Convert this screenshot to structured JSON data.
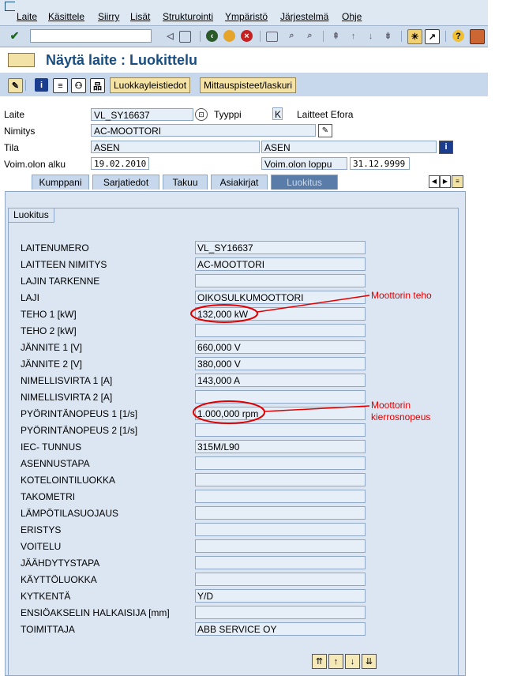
{
  "menu": {
    "items": [
      "Laite",
      "Käsittele",
      "Siirry",
      "Lisät",
      "Strukturointi",
      "Ympäristö",
      "Järjestelmä",
      "Ohje"
    ]
  },
  "title": "Näytä laite : Luokittelu",
  "app_buttons": {
    "general_data": "Luokkayleistiedot",
    "measuring_points": "Mittauspisteet/laskuri"
  },
  "header": {
    "equipment_label": "Laite",
    "equipment_value": "VL_SY16637",
    "type_label": "Tyyppi",
    "type_value": "K",
    "category_text": "Laitteet Efora",
    "description_label": "Nimitys",
    "description_value": "AC-MOOTTORI",
    "status_label": "Tila",
    "status_value_1": "ASEN",
    "status_value_2": "ASEN",
    "valid_from_label": "Voim.olon alku",
    "valid_from_value": "19.02.2010",
    "valid_to_label": "Voim.olon loppu",
    "valid_to_value": "31.12.9999"
  },
  "tabs": [
    "Kumppani",
    "Sarjatiedot",
    "Takuu",
    "Asiakirjat",
    "Luokitus"
  ],
  "group_title": "Luokitus",
  "characteristics": [
    {
      "label": "LAITENUMERO",
      "value": "VL_SY16637"
    },
    {
      "label": "LAITTEEN NIMITYS",
      "value": "AC-MOOTTORI"
    },
    {
      "label": "LAJIN TARKENNE",
      "value": ""
    },
    {
      "label": "LAJI",
      "value": "OIKOSULKUMOOTTORI"
    },
    {
      "label": "TEHO 1 [kW]",
      "value": "132,000 kW"
    },
    {
      "label": "TEHO 2 [kW]",
      "value": ""
    },
    {
      "label": "JÄNNITE 1 [V]",
      "value": "660,000 V"
    },
    {
      "label": "JÄNNITE 2 [V]",
      "value": "380,000 V"
    },
    {
      "label": "NIMELLISVIRTA 1 [A]",
      "value": "143,000 A"
    },
    {
      "label": "NIMELLISVIRTA 2 [A]",
      "value": ""
    },
    {
      "label": "PYÖRINTÄNOPEUS 1 [1/s]",
      "value": "1.000,000 rpm"
    },
    {
      "label": "PYÖRINTÄNOPEUS 2  [1/s]",
      "value": ""
    },
    {
      "label": "IEC- TUNNUS",
      "value": "315M/L90"
    },
    {
      "label": "ASENNUSTAPA",
      "value": ""
    },
    {
      "label": "KOTELOINTILUOKKA",
      "value": ""
    },
    {
      "label": "TAKOMETRI",
      "value": ""
    },
    {
      "label": "LÄMPÖTILASUOJAUS",
      "value": ""
    },
    {
      "label": "ERISTYS",
      "value": ""
    },
    {
      "label": "VOITELU",
      "value": ""
    },
    {
      "label": "JÄÄHDYTYSTAPA",
      "value": ""
    },
    {
      "label": "KÄYTTÖLUOKKA",
      "value": ""
    },
    {
      "label": "KYTKENTÄ",
      "value": "Y/D"
    },
    {
      "label": "ENSIÖAKSELIN HALKAISIJA [mm]",
      "value": ""
    },
    {
      "label": "TOIMITTAJA",
      "value": "ABB SERVICE OY"
    }
  ],
  "annotations": {
    "power": "Moottorin teho",
    "speed_line1": "Moottorin",
    "speed_line2": "kierrosnopeus",
    "color": "#e00000"
  },
  "icons": {
    "toolbar": [
      "checkmark-icon",
      "back-icon",
      "exit-icon",
      "cancel-icon",
      "print-icon",
      "find-icon",
      "find-next-icon",
      "first-page-icon",
      "prev-page-icon",
      "next-page-icon",
      "last-page-icon",
      "new-session-icon",
      "shortcut-icon",
      "help-icon",
      "layout-icon"
    ],
    "bottom": [
      "first-entry-icon",
      "prev-entry-icon",
      "next-entry-icon",
      "last-entry-icon"
    ]
  }
}
